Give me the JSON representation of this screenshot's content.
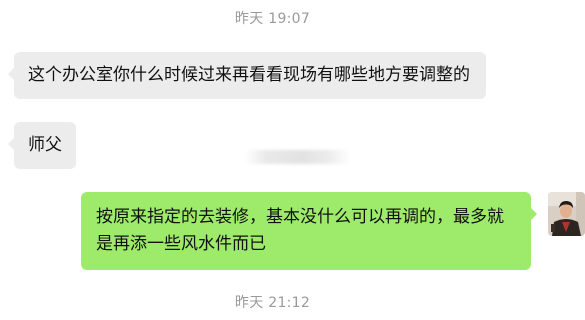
{
  "chat": {
    "timestamps": [
      "昨天 19:07",
      "昨天 21:12"
    ],
    "messages": [
      {
        "side": "incoming",
        "text": "这个办公室你什么时候过来再看看现场有哪些地方要调整的"
      },
      {
        "side": "incoming",
        "text": "师父"
      },
      {
        "side": "outgoing",
        "text": "按原来指定的去装修，基本没什么可以再调的，最多就是再添一些风水件而已"
      }
    ]
  },
  "avatar": {
    "icon": "user-avatar-photo"
  },
  "colors": {
    "incoming_bubble": "#ececec",
    "outgoing_bubble": "#9eea6a",
    "timestamp_text": "#9a9a9a",
    "background": "#ffffff"
  }
}
